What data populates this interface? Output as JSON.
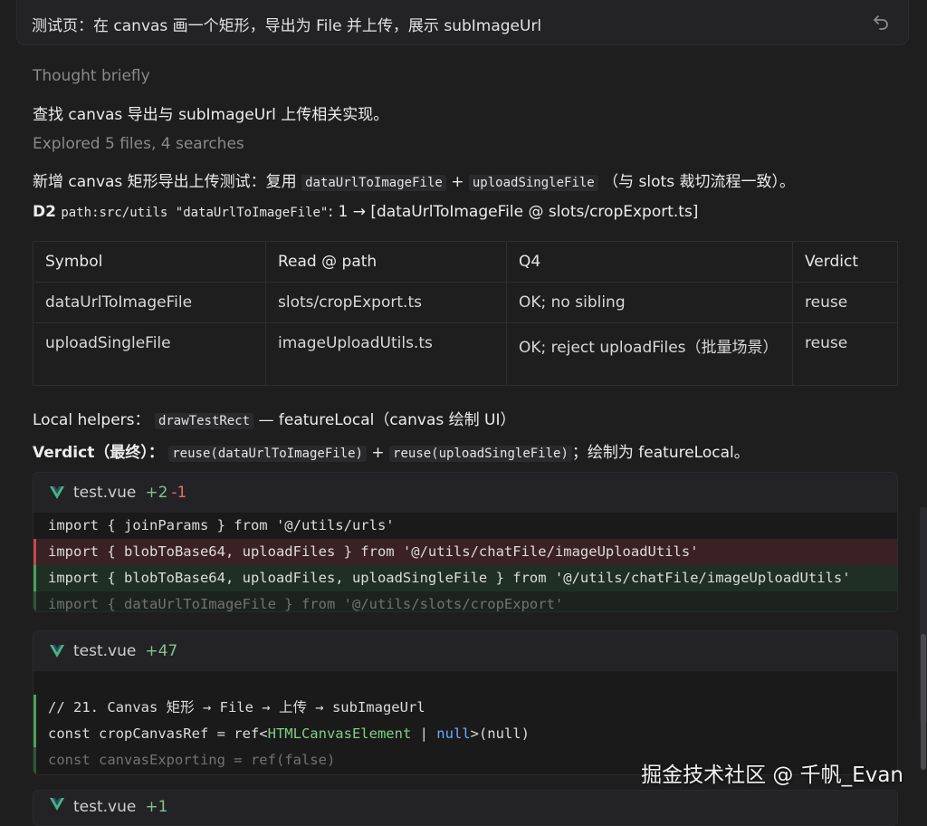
{
  "header": {
    "title": "测试页：在 canvas 画一个矩形，导出为 File 并上传，展示 subImageUrl"
  },
  "thought": "Thought briefly",
  "goal": "查找 canvas 导出与 subImageUrl 上传相关实现。",
  "explored": "Explored 5 files, 4 searches",
  "plan": {
    "prefix": "新增 canvas 矩形导出上传测试：复用",
    "code1": "dataUrlToImageFile",
    "plus": "+",
    "code2": "uploadSingleFile",
    "suffix": "（与 slots 裁切流程一致）。"
  },
  "d2": {
    "label": "D2",
    "code": "path:src/utils \"dataUrlToImageFile\"",
    "rest": ": 1 → [dataUrlToImageFile @ slots/cropExport.ts]"
  },
  "table": {
    "headers": [
      "Symbol",
      "Read @ path",
      "Q4",
      "Verdict"
    ],
    "rows": [
      [
        "dataUrlToImageFile",
        "slots/cropExport.ts",
        "OK; no sibling",
        "reuse"
      ],
      [
        "uploadSingleFile",
        "imageUploadUtils.ts",
        "OK; reject uploadFiles（批量场景）",
        "reuse"
      ]
    ]
  },
  "local_helpers": {
    "label": "Local helpers：",
    "code": "drawTestRect",
    "rest": "— featureLocal（canvas 绘制 UI）"
  },
  "verdict": {
    "label": "Verdict（最终）：",
    "code1": "reuse(dataUrlToImageFile)",
    "plus": "+",
    "code2": "reuse(uploadSingleFile)",
    "rest": "；绘制为 featureLocal。"
  },
  "diff1": {
    "file": "test.vue",
    "added": "+2",
    "removed": "-1",
    "lines": [
      "import { joinParams } from '@/utils/urls'",
      "import { blobToBase64, uploadFiles } from '@/utils/chatFile/imageUploadUtils'",
      "import { blobToBase64, uploadFiles, uploadSingleFile } from '@/utils/chatFile/imageUploadUtils'",
      "import { dataUrlToImageFile } from '@/utils/slots/cropExport'"
    ]
  },
  "diff2": {
    "file": "test.vue",
    "added": "+47",
    "line1": "// 21. Canvas 矩形 → File → 上传 → subImageUrl",
    "line2a": "const cropCanvasRef = ref<",
    "line2b": "HTMLCanvasElement",
    "line2c": " | ",
    "line2d": "null",
    "line2e": ">(null)",
    "line3": "const canvasExporting = ref(false)"
  },
  "diff3": {
    "file": "test.vue",
    "added": "+1"
  },
  "watermark": "掘金技术社区 @ 千帆_Evan",
  "icons": {
    "undo": "undo-icon",
    "vue": "vue-icon"
  },
  "colors": {
    "added": "#7fc48a",
    "removed": "#e06c6c",
    "background": "#1e1e1f"
  }
}
